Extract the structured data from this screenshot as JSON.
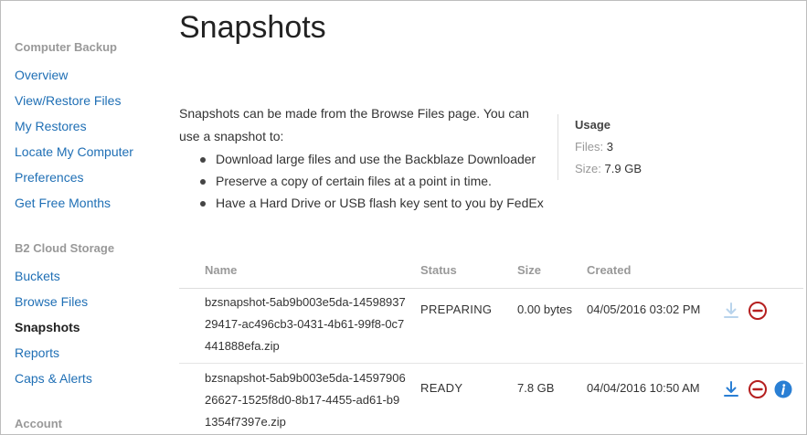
{
  "sidebar": {
    "sections": [
      {
        "title": "Computer Backup",
        "items": [
          {
            "label": "Overview"
          },
          {
            "label": "View/Restore Files"
          },
          {
            "label": "My Restores"
          },
          {
            "label": "Locate My Computer"
          },
          {
            "label": "Preferences"
          },
          {
            "label": "Get Free Months"
          }
        ]
      },
      {
        "title": "B2 Cloud Storage",
        "items": [
          {
            "label": "Buckets"
          },
          {
            "label": "Browse Files"
          },
          {
            "label": "Snapshots",
            "active": true
          },
          {
            "label": "Reports"
          },
          {
            "label": "Caps & Alerts"
          }
        ]
      },
      {
        "title": "Account",
        "items": []
      }
    ]
  },
  "main": {
    "title": "Snapshots",
    "intro": "Snapshots can be made from the Browse Files page. You can use a snapshot to:",
    "bullets": [
      "Download large files and use the Backblaze Downloader",
      "Preserve a copy of certain files at a point in time.",
      "Have a Hard Drive or USB flash key sent to you by FedEx"
    ]
  },
  "usage": {
    "title": "Usage",
    "files_label": "Files:",
    "files_value": "3",
    "size_label": "Size:",
    "size_value": "7.9 GB"
  },
  "table": {
    "columns": [
      "Name",
      "Status",
      "Size",
      "Created"
    ],
    "rows": [
      {
        "name": "bzsnapshot-5ab9b003e5da-1459893729417-ac496cb3-0431-4b61-99f8-0c7441888efa.zip",
        "status": "PREPARING",
        "size": "0.00 bytes",
        "created": "04/05/2016 03:02 PM",
        "download_enabled": false,
        "info": false
      },
      {
        "name": "bzsnapshot-5ab9b003e5da-1459790626627-1525f8d0-8b17-4455-ad61-b91354f7397e.zip",
        "status": "READY",
        "size": "7.8 GB",
        "created": "04/04/2016 10:50 AM",
        "download_enabled": true,
        "info": true
      }
    ]
  },
  "icons": {
    "download": "download-icon",
    "delete": "remove-circle-icon",
    "info": "info-icon"
  },
  "colors": {
    "link": "#1f6fb5",
    "delete": "#b51f1f",
    "download_enabled": "#2a7fd4",
    "download_disabled": "#b9d4ec",
    "info": "#2a7fd4"
  }
}
